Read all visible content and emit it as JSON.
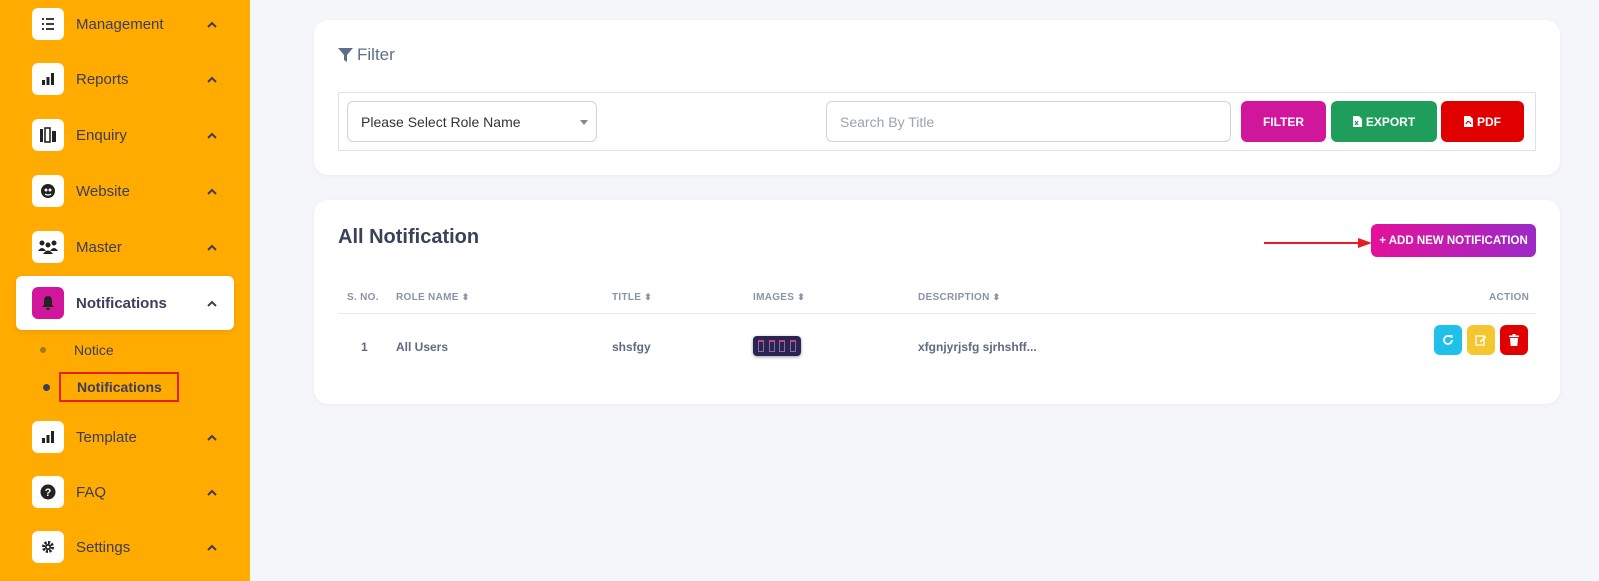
{
  "sidebar": {
    "items": [
      {
        "label": "Management",
        "icon": "checklist-icon"
      },
      {
        "label": "Reports",
        "icon": "bar-chart-icon"
      },
      {
        "label": "Enquiry",
        "icon": "enquiry-icon"
      },
      {
        "label": "Website",
        "icon": "website-icon"
      },
      {
        "label": "Master",
        "icon": "users-group-icon"
      },
      {
        "label": "Notifications",
        "icon": "bell-icon"
      },
      {
        "label": "Template",
        "icon": "bar-chart-icon"
      },
      {
        "label": "FAQ",
        "icon": "question-circle-icon"
      },
      {
        "label": "Settings",
        "icon": "gear-icon"
      }
    ],
    "sub_items": [
      {
        "label": "Notice"
      },
      {
        "label": "Notifications"
      }
    ],
    "accent": "#ffab00",
    "active_color": "#d0169b"
  },
  "filter": {
    "title": "Filter",
    "role_select": "Please Select Role Name",
    "search_placeholder": "Search By Title",
    "filter_label": "FILTER",
    "export_label": "EXPORT",
    "pdf_label": "PDF"
  },
  "list": {
    "title": "All Notification",
    "add_label": "+ ADD NEW NOTIFICATION",
    "columns": [
      "S. NO.",
      "ROLE NAME",
      "TITLE",
      "IMAGES",
      "DESCRIPTION",
      "ACTION"
    ],
    "rows": [
      {
        "sno": "1",
        "role": "All Users",
        "title": "shsfgy",
        "description": "xfgnjyrjsfg sjrhshff..."
      }
    ]
  },
  "colors": {
    "filter_btn": "#d0169b",
    "export_btn": "#1e9e5a",
    "pdf_btn": "#e00000",
    "refresh_btn": "#1fc0ea",
    "edit_btn": "#f5c62f",
    "delete_btn": "#e00000"
  }
}
